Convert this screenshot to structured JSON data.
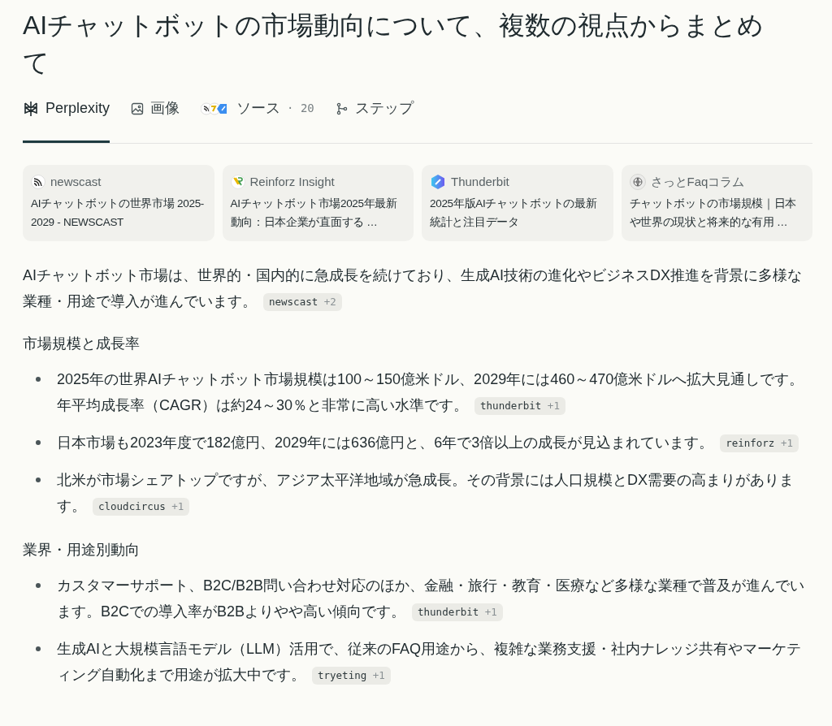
{
  "title": "AIチャットボットの市場動向について、複数の視点からまとめて",
  "tabs": [
    {
      "kind": "perplexity",
      "label": "Perplexity",
      "selected": true
    },
    {
      "kind": "images",
      "label": "画像",
      "selected": false
    },
    {
      "kind": "sources",
      "label": "ソース",
      "count": "· 20",
      "selected": false
    },
    {
      "kind": "steps",
      "label": "ステップ",
      "selected": false
    }
  ],
  "source_cards": [
    {
      "kind": "newscast",
      "site": "newscast",
      "headline": "AIチャットボットの世界市場 2025-2029 - NEWSCAST"
    },
    {
      "kind": "reinforz",
      "site": "Reinforz Insight",
      "headline": "AIチャットボット市場2025年最新動向：日本企業が直面する …"
    },
    {
      "kind": "thunderbit",
      "site": "Thunderbit",
      "headline": "2025年版AIチャットボットの最新統計と注目データ"
    },
    {
      "kind": "globe",
      "site": "さっとFaqコラム",
      "headline": "チャットボットの市場規模｜日本や世界の現状と将来的な有用 …"
    }
  ],
  "answer": [
    {
      "kind": "paragraph",
      "text": "AIチャットボット市場は、世界的・国内的に急成長を続けており、生成AI技術の進化やビジネスDX推進を背景に多様な業種・用途で導入が進んでいます。",
      "citation": {
        "source": "newscast",
        "count": "+2"
      }
    },
    {
      "kind": "heading",
      "text": "市場規模と成長率"
    },
    {
      "kind": "bullet",
      "text": "2025年の世界AIチャットボット市場規模は100～150億米ドル、2029年には460～470億米ドルへ拡大見通しです。年平均成長率（CAGR）は約24～30％と非常に高い水準です。",
      "citation": {
        "source": "thunderbit",
        "count": "+1"
      }
    },
    {
      "kind": "bullet",
      "text": "日本市場も2023年度で182億円、2029年には636億円と、6年で3倍以上の成長が見込まれています。",
      "citation": {
        "source": "reinforz",
        "count": "+1"
      }
    },
    {
      "kind": "bullet",
      "text": "北米が市場シェアトップですが、アジア太平洋地域が急成長。その背景には人口規模とDX需要の高まりがあります。",
      "citation": {
        "source": "cloudcircus",
        "count": "+1"
      }
    },
    {
      "kind": "heading",
      "text": "業界・用途別動向"
    },
    {
      "kind": "bullet",
      "text": "カスタマーサポート、B2C/B2B問い合わせ対応のほか、金融・旅行・教育・医療など多様な業種で普及が進んでいます。B2Cでの導入率がB2Bよりやや高い傾向です。",
      "citation": {
        "source": "thunderbit",
        "count": "+1"
      }
    },
    {
      "kind": "bullet",
      "text": "生成AIと大規模言語モデル（LLM）活用で、従来のFAQ用途から、複雑な業務支援・社内ナレッジ共有やマーケティング自動化まで用途が拡大中です。",
      "citation": {
        "source": "tryeting",
        "count": "+1"
      }
    }
  ]
}
